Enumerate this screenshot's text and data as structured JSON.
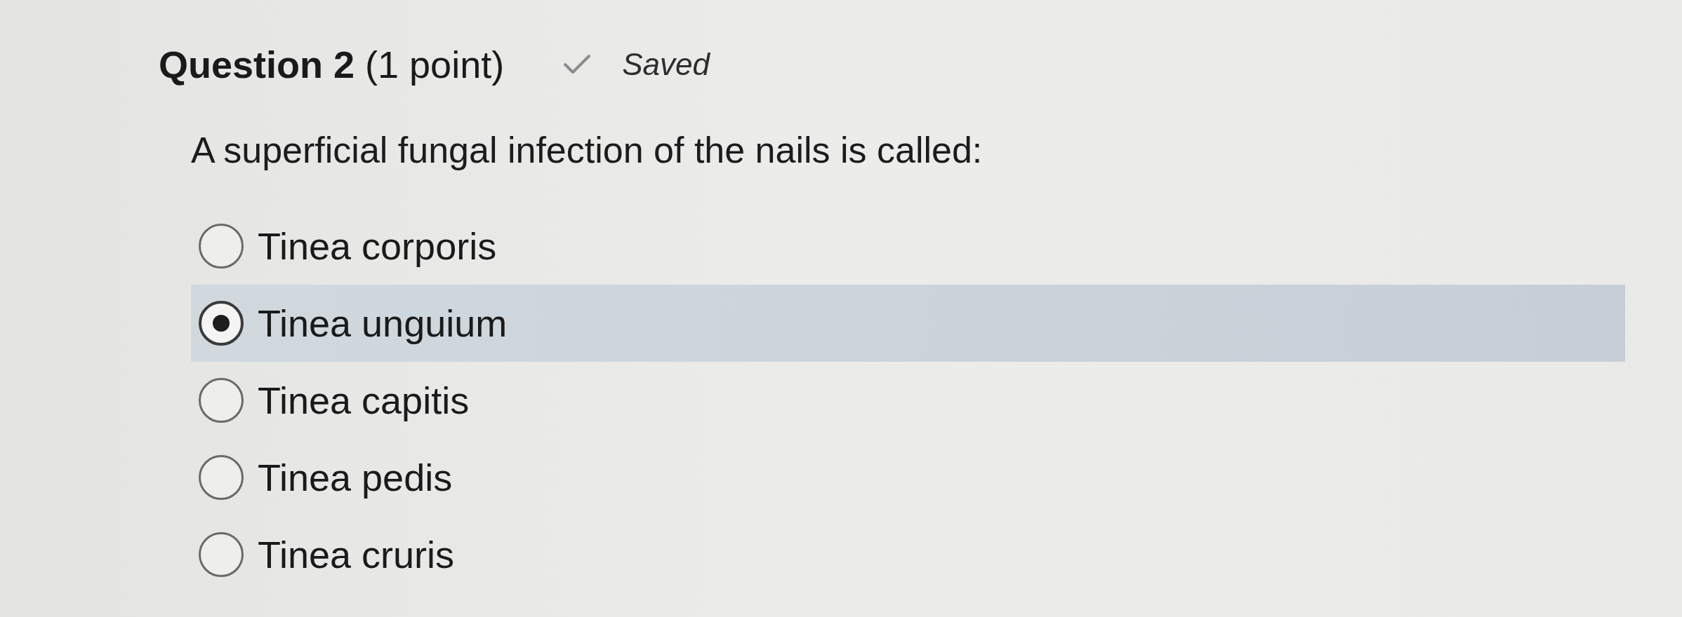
{
  "question": {
    "title": "**Question 2** (1 point)",
    "status": "Saved",
    "prompt": "A superficial fungal infection of the nails is called:"
  },
  "options": [
    {
      "label": "Tinea corporis",
      "selected": false
    },
    {
      "label": "Tinea unguium",
      "selected": true
    },
    {
      "label": "Tinea capitis",
      "selected": false
    },
    {
      "label": "Tinea pedis",
      "selected": false
    },
    {
      "label": "Tinea cruris",
      "selected": false
    }
  ]
}
